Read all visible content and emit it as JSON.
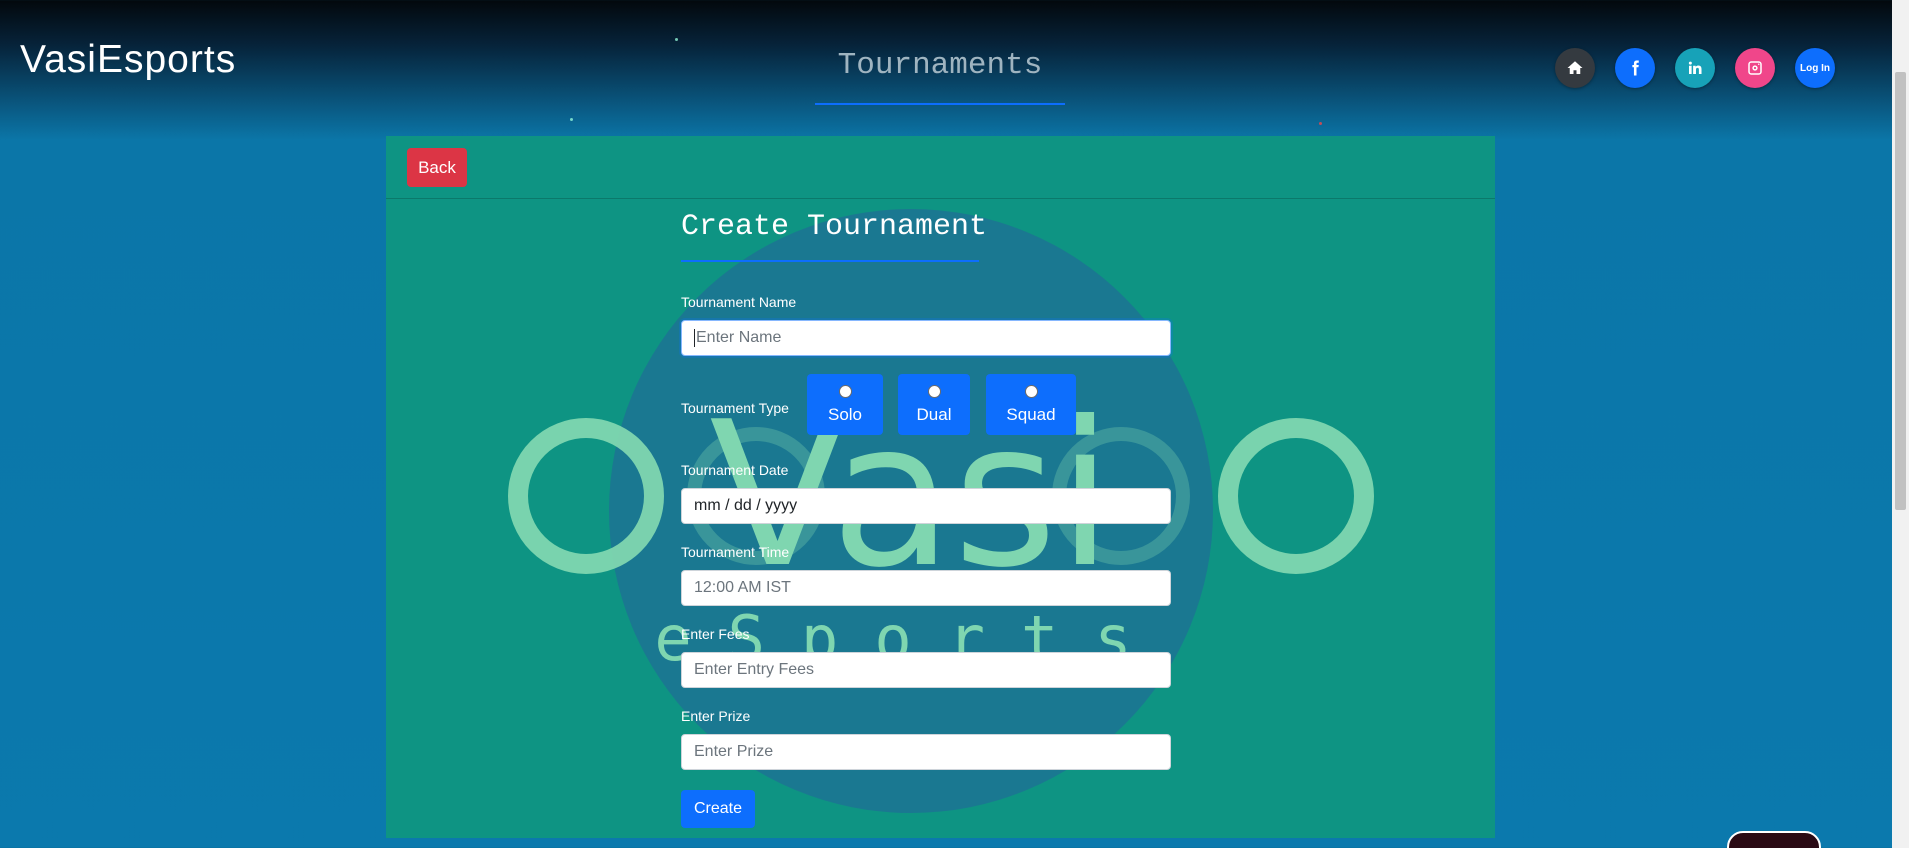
{
  "header": {
    "brand": "VasiEsports",
    "page_title": "Tournaments"
  },
  "social": [
    {
      "icon": "home-icon",
      "color": "#343a40"
    },
    {
      "icon": "facebook-icon",
      "color": "#0d6efd"
    },
    {
      "icon": "linkedin-icon",
      "color": "#17a2b8"
    },
    {
      "icon": "instagram-icon",
      "color": "#f0468a"
    },
    {
      "icon": "login",
      "color": "#0d6efd",
      "label": "Log In"
    }
  ],
  "panel": {
    "back_label": "Back",
    "form_title": "Create Tournament",
    "name": {
      "label": "Tournament Name",
      "placeholder": "Enter Name",
      "value": ""
    },
    "type": {
      "label": "Tournament Type",
      "options": [
        "Solo",
        "Dual",
        "Squad"
      ],
      "selected": null
    },
    "date": {
      "label": "Tournament Date",
      "value": "mm / dd / yyyy"
    },
    "time": {
      "label": "Tournament Time",
      "value": "12:00 AM IST"
    },
    "fees": {
      "label": "Enter Fees",
      "placeholder": "Enter Entry Fees"
    },
    "prize": {
      "label": "Enter Prize",
      "placeholder": "Enter Prize"
    },
    "create_label": "Create"
  },
  "watermark": {
    "word": "Vasi",
    "tagline": "eSports"
  },
  "colors": {
    "panel": "#0e9483",
    "primary": "#0d6efd",
    "danger": "#dc3545",
    "accent_line": "#0d6efd"
  }
}
